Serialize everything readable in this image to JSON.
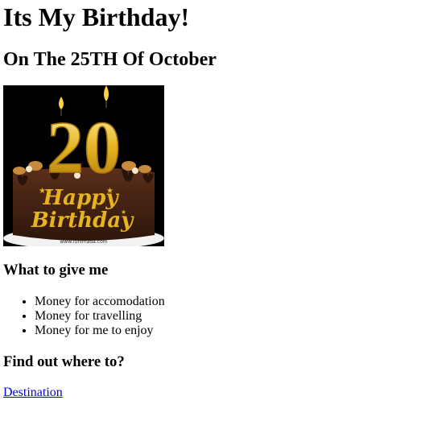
{
  "title": "Its My Birthday!",
  "subtitle": "On The 25TH Of October",
  "image": {
    "number": "20",
    "caption_line1": "Happy",
    "caption_line2": "Birthday",
    "watermark": "www.funimada.com"
  },
  "gifts": {
    "heading": "What to give me",
    "items": [
      "Money for accomodation",
      "Money for travelling",
      "Money for me to enjoy"
    ]
  },
  "find": {
    "heading": "Find out where to?",
    "link_label": "Destination"
  },
  "colors": {
    "link": "#0000ee",
    "gold": "#e6b422",
    "cake": "#4a2616"
  }
}
